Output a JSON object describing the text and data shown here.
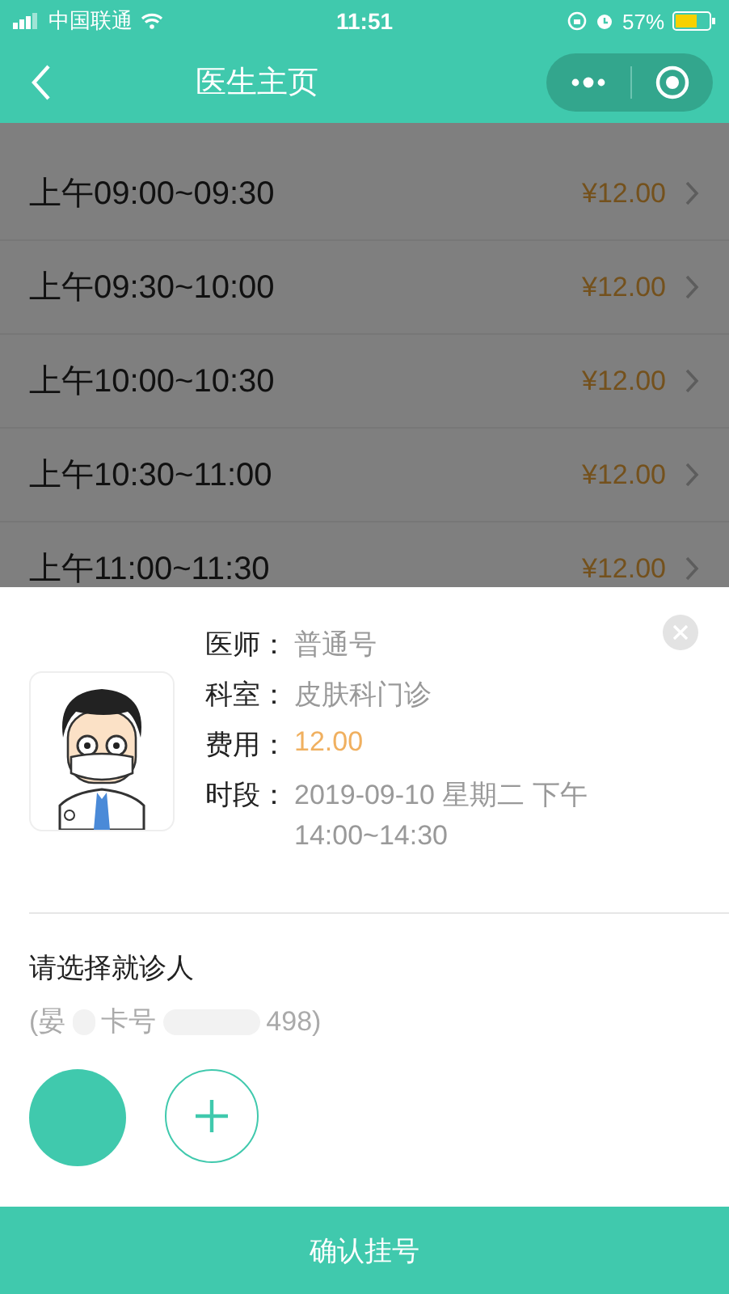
{
  "status_bar": {
    "carrier": "中国联通",
    "time": "11:51",
    "battery": "57%"
  },
  "nav": {
    "title": "医生主页"
  },
  "time_slots": [
    {
      "time": "上午09:00~09:30",
      "price": "¥12.00"
    },
    {
      "time": "上午09:30~10:00",
      "price": "¥12.00"
    },
    {
      "time": "上午10:00~10:30",
      "price": "¥12.00"
    },
    {
      "time": "上午10:30~11:00",
      "price": "¥12.00"
    },
    {
      "time": "上午11:00~11:30",
      "price": "¥12.00"
    }
  ],
  "sheet": {
    "details": [
      {
        "label": "医师：",
        "kind": "plain",
        "lines": [
          "普通号"
        ]
      },
      {
        "label": "科室：",
        "kind": "plain",
        "lines": [
          "皮肤科门诊"
        ]
      },
      {
        "label": "费用：",
        "kind": "price",
        "lines": [
          "12.00"
        ]
      },
      {
        "label": "时段：",
        "kind": "plain",
        "lines": [
          "2019-09-10 星期二 下午",
          "14:00~14:30"
        ]
      }
    ],
    "patient_prompt": "请选择就诊人",
    "patient_info": [
      "(晏",
      "卡号",
      "498)"
    ],
    "patients": [
      {
        "selected": true
      }
    ],
    "confirm_button": "确认挂号"
  }
}
